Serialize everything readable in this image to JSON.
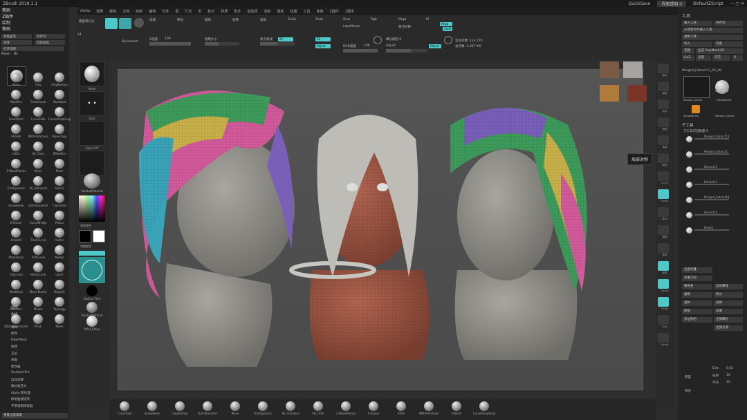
{
  "window": {
    "title": "ZBrush 2019.1.1",
    "quicksave": "QuickSave",
    "transparency_field": "界面透明 0",
    "script_field": "DefaultZScript"
  },
  "menubar": [
    "Alpha",
    "笔刷",
    "颜色",
    "文档",
    "绘制",
    "编辑",
    "文件",
    "层",
    "灯光",
    "宏",
    "标记",
    "材质",
    "影片",
    "首选项",
    "渲染",
    "模板",
    "纹理",
    "工具",
    "变换",
    "Z插件",
    "Z脚本"
  ],
  "left_tray": {
    "headers": [
      "笔刷",
      "Z插件",
      "绘制",
      "笔刷"
    ],
    "buttons": [
      "加载画笔",
      "另存为",
      "克隆",
      "选择画笔",
      "打开笔刷",
      "Move",
      "B2"
    ],
    "brushes": [
      {
        "label": "Move"
      },
      {
        "label": "Clay"
      },
      {
        "label": "ClayBuildup"
      },
      {
        "label": "MaskPen"
      },
      {
        "label": "Snakehook"
      },
      {
        "label": "Standard"
      },
      {
        "label": "SelectRect"
      },
      {
        "label": "CurveTube"
      },
      {
        "label": "CurveStrapSnap"
      },
      {
        "label": "hPolish"
      },
      {
        "label": "IMM Primitives"
      },
      {
        "label": "Move Topo"
      },
      {
        "label": "Inflat"
      },
      {
        "label": "SK_Cloth"
      },
      {
        "label": "ZModeler"
      },
      {
        "label": "Z-WoodPlanks"
      },
      {
        "label": "Move"
      },
      {
        "label": "Pinch"
      },
      {
        "label": "TrimDynamic"
      },
      {
        "label": "SK_Standard"
      },
      {
        "label": "Slash3"
      },
      {
        "label": "SnakeHook"
      },
      {
        "label": "DamStandard"
      },
      {
        "label": "ClayTubes"
      },
      {
        "label": "Z-Eraser"
      },
      {
        "label": "CurveBridge"
      },
      {
        "label": "Planar"
      },
      {
        "label": "Smooth"
      },
      {
        "label": "TrackCurve"
      },
      {
        "label": "Flatten"
      },
      {
        "label": "MaskLasso"
      },
      {
        "label": "TrimCurve"
      },
      {
        "label": "Nudge"
      },
      {
        "label": "ClipCurve"
      },
      {
        "label": "MaskCurve"
      },
      {
        "label": "Layer"
      },
      {
        "label": "MaskRect"
      },
      {
        "label": "Move Elastic"
      },
      {
        "label": "Magnify"
      },
      {
        "label": "MaskPen"
      },
      {
        "label": "Morph"
      },
      {
        "label": "Topology"
      },
      {
        "label": "ZRemesherGuide"
      },
      {
        "label": "Pinch"
      },
      {
        "label": "Noise"
      }
    ],
    "menu": [
      "创建",
      "曲线",
      "深度",
      "采样",
      "修改",
      "FiberMesh",
      "经典",
      "方位",
      "表面",
      "修改器",
      "ScultprisPro",
      "自动遮罩",
      "数位板压力",
      "Alpha 和纹理",
      "修剪曲线选项",
      "平滑笔刷修改器"
    ],
    "footer": "重置当前笔刷"
  },
  "toolbar": {
    "items": [
      "模型和灯光",
      "选择",
      "移动",
      "缩放",
      "旋转",
      "画笔",
      "Zadd",
      "Zsub",
      "Zcut",
      "Rgb",
      "Mrgb",
      "M"
    ],
    "sliders": [
      {
        "label": "Z强度",
        "value": "100"
      },
      {
        "label": "绘制大小",
        "value": "64"
      },
      {
        "label": "焦点衰减",
        "value": "0"
      },
      {
        "label": "RGB强度",
        "value": "100"
      }
    ],
    "labels": [
      "Dynamesh",
      "LazyMouse",
      "激活对称",
      "细分级别 0",
      "活动点数: 114,770",
      "总点数: 2.007 Mil",
      "Focal Shift",
      "Draw Size",
      "S4",
      "Z1",
      "Z3",
      "Adjust",
      "Mrgb",
      "Zadd",
      "Zsub"
    ]
  },
  "shelf": {
    "items": [
      {
        "label": "Move"
      },
      {
        "label": "Dots"
      },
      {
        "label": "Alpha Off"
      },
      {
        "label": "Texture Off"
      },
      {
        "label": "StartupMaterial"
      },
      {
        "label": "Outline Thin"
      },
      {
        "label": "MAH_Shiny"
      }
    ],
    "color_label": "渐变颜色",
    "swap_label": "切换颜色"
  },
  "right_icons": [
    "滚动",
    "缩放",
    "实际",
    "透视",
    "地面",
    "局部",
    "L.Sym",
    "Frame",
    "移动",
    "缩放",
    "旋转",
    "线框",
    "Transp",
    "Ghost",
    "Solo",
    "Xpose"
  ],
  "tooltip": "局部对称",
  "right_panel": {
    "title": "工具",
    "buttons": [
      "载入工具",
      "另存为",
      "从项目文件载入工具",
      "复制工具",
      "导入",
      "导出",
      "克隆",
      "生成 PolyMesh3D",
      "GoZ",
      "全部",
      "可见",
      "R"
    ],
    "active_tool": "Merged_Extract13_25_48",
    "thumbs": [
      "Merged_Extract",
      "Cylinder3D",
      "PolyMesh3D",
      "SimpleBrush",
      "Merged_Extract"
    ],
    "subtool_header": "子工具",
    "subtool_label": "子工具可见数量 9",
    "subtools": [
      "Merged_Extract13",
      "Merged_Extract1",
      "Extract13",
      "Extract11",
      "Merged_Extract18",
      "Extract12",
      "Hood2"
    ],
    "actions": [
      "全部折叠",
      "双重几何",
      "重命名",
      "自动重排",
      "复制",
      "拆分",
      "合并",
      "投射",
      "提取",
      "遮罩",
      "多边形组",
      "全部细分",
      "全部光滑",
      "厚度",
      "预览"
    ],
    "sliders": [
      {
        "label": "Dist",
        "value": "0.02"
      },
      {
        "label": "投射",
        "value": "10"
      },
      {
        "label": "平均",
        "value": "10"
      }
    ]
  },
  "bottom_shelf": [
    "CurveTube",
    "SnakeHook",
    "ClayBuildup",
    "DamStandard",
    "Move",
    "TrimDynamic",
    "SK_Standard",
    "SK_Cloth",
    "Z-WoodPlanks",
    "Z-Eraser",
    "Inflat",
    "IMM Primitives",
    "hPolish",
    "CurveStrapSnap"
  ],
  "texture_thumbs": [
    "face-texture",
    "gray-texture",
    "wood-texture",
    "brown-texture"
  ]
}
